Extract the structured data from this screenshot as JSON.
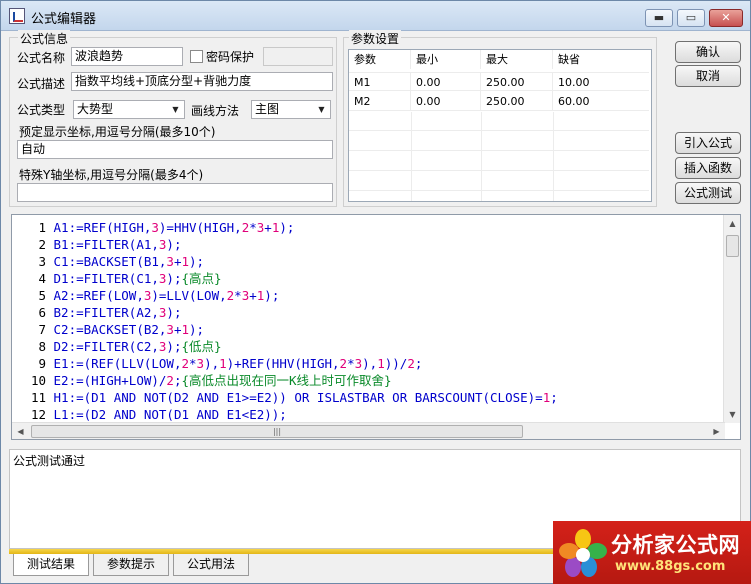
{
  "window": {
    "title": "公式编辑器",
    "minimize": "▬",
    "maximize": "▭",
    "close": "✕"
  },
  "formula_info": {
    "group_label": "公式信息",
    "name_label": "公式名称",
    "name_value": "波浪趋势",
    "password_label": "密码保护",
    "desc_label": "公式描述",
    "desc_value": "指数平均线+顶底分型+背驰力度",
    "type_label": "公式类型",
    "type_value": "大势型",
    "draw_label": "画线方法",
    "draw_value": "主图",
    "coords_label": "预定显示坐标,用逗号分隔(最多10个)",
    "coords_value": "自动",
    "y_axis_label": "特殊Y轴坐标,用逗号分隔(最多4个)",
    "y_axis_value": ""
  },
  "params": {
    "group_label": "参数设置",
    "headers": [
      "参数",
      "最小",
      "最大",
      "缺省"
    ],
    "rows": [
      {
        "name": "M1",
        "min": "0.00",
        "max": "250.00",
        "default": "10.00"
      },
      {
        "name": "M2",
        "min": "0.00",
        "max": "250.00",
        "default": "60.00"
      }
    ]
  },
  "buttons": {
    "ok": "确认",
    "cancel": "取消",
    "import": "引入公式",
    "insert": "插入函数",
    "test": "公式测试"
  },
  "code_lines": [
    [
      {
        "t": "A1:=REF(HIGH,",
        "c": "k"
      },
      {
        "t": "3",
        "c": "n"
      },
      {
        "t": ")=HHV(HIGH,",
        "c": "k"
      },
      {
        "t": "2",
        "c": "n"
      },
      {
        "t": "*",
        "c": "k"
      },
      {
        "t": "3",
        "c": "n"
      },
      {
        "t": "+",
        "c": "k"
      },
      {
        "t": "1",
        "c": "n"
      },
      {
        "t": ");",
        "c": "k"
      }
    ],
    [
      {
        "t": "B1:=FILTER(A1,",
        "c": "k"
      },
      {
        "t": "3",
        "c": "n"
      },
      {
        "t": ");",
        "c": "k"
      }
    ],
    [
      {
        "t": "C1:=BACKSET(B1,",
        "c": "k"
      },
      {
        "t": "3",
        "c": "n"
      },
      {
        "t": "+",
        "c": "k"
      },
      {
        "t": "1",
        "c": "n"
      },
      {
        "t": ");",
        "c": "k"
      }
    ],
    [
      {
        "t": "D1:=FILTER(C1,",
        "c": "k"
      },
      {
        "t": "3",
        "c": "n"
      },
      {
        "t": ");",
        "c": "k"
      },
      {
        "t": "{高点}",
        "c": "m"
      }
    ],
    [
      {
        "t": "A2:=REF(LOW,",
        "c": "k"
      },
      {
        "t": "3",
        "c": "n"
      },
      {
        "t": ")=LLV(LOW,",
        "c": "k"
      },
      {
        "t": "2",
        "c": "n"
      },
      {
        "t": "*",
        "c": "k"
      },
      {
        "t": "3",
        "c": "n"
      },
      {
        "t": "+",
        "c": "k"
      },
      {
        "t": "1",
        "c": "n"
      },
      {
        "t": ");",
        "c": "k"
      }
    ],
    [
      {
        "t": "B2:=FILTER(A2,",
        "c": "k"
      },
      {
        "t": "3",
        "c": "n"
      },
      {
        "t": ");",
        "c": "k"
      }
    ],
    [
      {
        "t": "C2:=BACKSET(B2,",
        "c": "k"
      },
      {
        "t": "3",
        "c": "n"
      },
      {
        "t": "+",
        "c": "k"
      },
      {
        "t": "1",
        "c": "n"
      },
      {
        "t": ");",
        "c": "k"
      }
    ],
    [
      {
        "t": "D2:=FILTER(C2,",
        "c": "k"
      },
      {
        "t": "3",
        "c": "n"
      },
      {
        "t": ");",
        "c": "k"
      },
      {
        "t": "{低点}",
        "c": "m"
      }
    ],
    [
      {
        "t": "E1:=(REF(LLV(LOW,",
        "c": "k"
      },
      {
        "t": "2",
        "c": "n"
      },
      {
        "t": "*",
        "c": "k"
      },
      {
        "t": "3",
        "c": "n"
      },
      {
        "t": "),",
        "c": "k"
      },
      {
        "t": "1",
        "c": "n"
      },
      {
        "t": ")+REF(HHV(HIGH,",
        "c": "k"
      },
      {
        "t": "2",
        "c": "n"
      },
      {
        "t": "*",
        "c": "k"
      },
      {
        "t": "3",
        "c": "n"
      },
      {
        "t": "),",
        "c": "k"
      },
      {
        "t": "1",
        "c": "n"
      },
      {
        "t": "))/",
        "c": "k"
      },
      {
        "t": "2",
        "c": "n"
      },
      {
        "t": ";",
        "c": "k"
      }
    ],
    [
      {
        "t": "E2:=(HIGH+LOW)/",
        "c": "k"
      },
      {
        "t": "2",
        "c": "n"
      },
      {
        "t": ";",
        "c": "k"
      },
      {
        "t": "{高低点出现在同一K线上时可作取舍}",
        "c": "m"
      }
    ],
    [
      {
        "t": "H1:=(D1 AND NOT(D2 AND E1>=E2)) OR ISLASTBAR OR BARSCOUNT(CLOSE)=",
        "c": "k"
      },
      {
        "t": "1",
        "c": "n"
      },
      {
        "t": ";",
        "c": "k"
      }
    ],
    [
      {
        "t": "L1:=(D2 AND NOT(D1 AND E1<E2));",
        "c": "k"
      }
    ]
  ],
  "output_text": "公式测试通过",
  "tabs": [
    "测试结果",
    "参数提示",
    "公式用法"
  ],
  "watermark": {
    "title": "分析家公式网",
    "url": "www.88gs.com"
  },
  "colors": {
    "keyword": "#0000cc",
    "number": "#e0007a",
    "comment": "#0a8a2a",
    "tab_bar": "#f2c730",
    "watermark_bg": "#cc1f17"
  }
}
